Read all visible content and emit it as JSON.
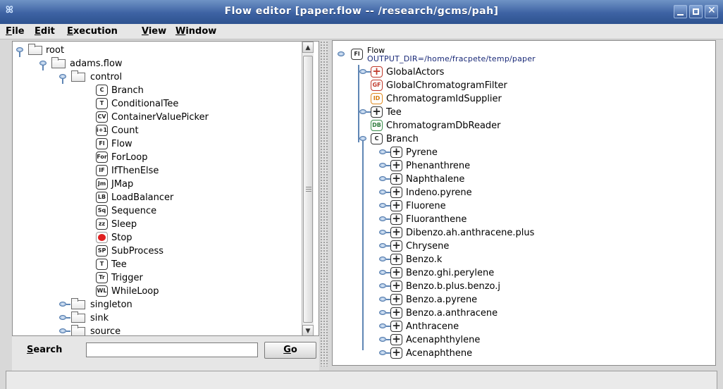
{
  "window": {
    "app_icon": "adams-logo-icon",
    "title": "Flow editor [paper.flow -- /research/gcms/pah]",
    "controls": [
      "minimize-icon",
      "maximize-icon",
      "close-icon"
    ]
  },
  "menubar": {
    "items": [
      {
        "mnemonic": "F",
        "rest": "ile"
      },
      {
        "mnemonic": "E",
        "rest": "dit"
      },
      {
        "mnemonic": "E",
        "rest": "xecution"
      },
      {
        "mnemonic": "V",
        "rest": "iew"
      },
      {
        "mnemonic": "W",
        "rest": "indow"
      }
    ]
  },
  "left_tree": {
    "nodes": [
      {
        "label": "root",
        "icon": "folder-icon"
      },
      {
        "label": "adams.flow",
        "icon": "folder-icon"
      },
      {
        "label": "control",
        "icon": "folder-icon"
      },
      {
        "label": "Branch",
        "icon": "C"
      },
      {
        "label": "ConditionalTee",
        "icon": "T"
      },
      {
        "label": "ContainerValuePicker",
        "icon": "CV"
      },
      {
        "label": "Count",
        "icon": "i+1"
      },
      {
        "label": "Flow",
        "icon": "Fl"
      },
      {
        "label": "ForLoop",
        "icon": "For"
      },
      {
        "label": "IfThenElse",
        "icon": "IF"
      },
      {
        "label": "JMap",
        "icon": "Jm"
      },
      {
        "label": "LoadBalancer",
        "icon": "LB"
      },
      {
        "label": "Sequence",
        "icon": "Sq"
      },
      {
        "label": "Sleep",
        "icon": "zz"
      },
      {
        "label": "Stop",
        "icon": "stop-icon"
      },
      {
        "label": "SubProcess",
        "icon": "SP"
      },
      {
        "label": "Tee",
        "icon": "T"
      },
      {
        "label": "Trigger",
        "icon": "Tr"
      },
      {
        "label": "WhileLoop",
        "icon": "WL"
      },
      {
        "label": "singleton",
        "icon": "folder-icon"
      },
      {
        "label": "sink",
        "icon": "folder-icon"
      },
      {
        "label": "source",
        "icon": "folder-icon"
      }
    ]
  },
  "search": {
    "label_mnemonic": "S",
    "label_rest": "earch",
    "value": "",
    "go_mnemonic": "G",
    "go_rest": "o"
  },
  "right_tree": {
    "root": {
      "label": "Flow",
      "icon": "Fl",
      "option": "OUTPUT_DIR=/home/fracpete/temp/paper"
    },
    "nodes": [
      {
        "label": "GlobalActors",
        "icon": "+",
        "color": "red"
      },
      {
        "label": "GlobalChromatogramFilter",
        "icon": "GF",
        "color": "red"
      },
      {
        "label": "ChromatogramIdSupplier",
        "icon": "ID",
        "color": "orange"
      },
      {
        "label": "Tee",
        "icon": "+"
      },
      {
        "label": "ChromatogramDbReader",
        "icon": "DB",
        "color": "green"
      },
      {
        "label": "Branch",
        "icon": "C"
      },
      {
        "label": "Pyrene",
        "icon": "+"
      },
      {
        "label": "Phenanthrene",
        "icon": "+"
      },
      {
        "label": "Naphthalene",
        "icon": "+"
      },
      {
        "label": "Indeno.pyrene",
        "icon": "+"
      },
      {
        "label": "Fluorene",
        "icon": "+"
      },
      {
        "label": "Fluoranthene",
        "icon": "+"
      },
      {
        "label": "Dibenzo.ah.anthracene.plus",
        "icon": "+"
      },
      {
        "label": "Chrysene",
        "icon": "+"
      },
      {
        "label": "Benzo.k",
        "icon": "+"
      },
      {
        "label": "Benzo.ghi.perylene",
        "icon": "+"
      },
      {
        "label": "Benzo.b.plus.benzo.j",
        "icon": "+"
      },
      {
        "label": "Benzo.a.pyrene",
        "icon": "+"
      },
      {
        "label": "Benzo.a.anthracene",
        "icon": "+"
      },
      {
        "label": "Anthracene",
        "icon": "+"
      },
      {
        "label": "Acenaphthylene",
        "icon": "+"
      },
      {
        "label": "Acenaphthene",
        "icon": "+"
      }
    ]
  },
  "statusbar": {
    "text": ""
  }
}
